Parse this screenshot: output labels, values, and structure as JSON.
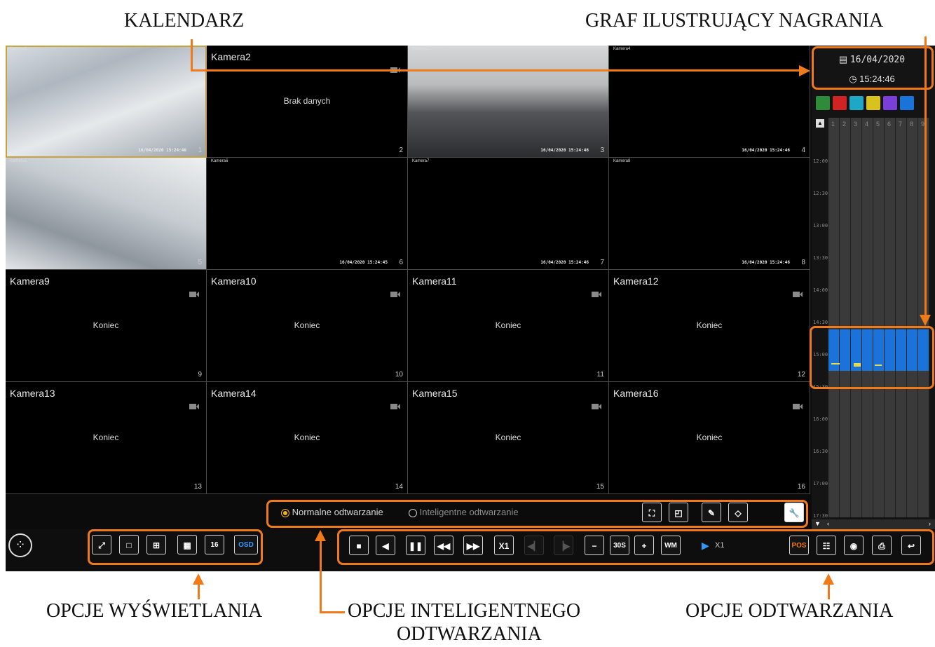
{
  "captions": {
    "calendar": "KALENDARZ",
    "recording_graph": "GRAF ILUSTRUJĄCY NAGRANIA",
    "display_options": "OPCJE WYŚWIETLANIA",
    "smart_playback_options_line1": "OPCJE INTELIGENTNEGO",
    "smart_playback_options_line2": "ODTWARZANIA",
    "playback_options": "OPCJE ODTWARZANIA"
  },
  "cameras": [
    {
      "name": "Kamera1",
      "status": "",
      "timestamp": "16/04/2020 15:24:46",
      "num": "1"
    },
    {
      "name": "Kamera2",
      "status": "Brak danych",
      "timestamp": "",
      "num": "2"
    },
    {
      "name": "Kamera3",
      "status": "",
      "timestamp": "16/04/2020 15:24:46",
      "num": "3"
    },
    {
      "name": "Kamera4",
      "status": "",
      "timestamp": "16/04/2020 15:24:46",
      "num": "4"
    },
    {
      "name": "Kamera5",
      "status": "",
      "timestamp": "",
      "num": "5"
    },
    {
      "name": "Kamera6",
      "status": "",
      "timestamp": "16/04/2020 15:24:45",
      "num": "6"
    },
    {
      "name": "Kamera7",
      "status": "",
      "timestamp": "16/04/2020 15:24:46",
      "num": "7"
    },
    {
      "name": "Kamera8",
      "status": "",
      "timestamp": "16/04/2020 15:24:46",
      "num": "8"
    },
    {
      "name": "Kamera9",
      "status": "Koniec",
      "timestamp": "",
      "num": "9"
    },
    {
      "name": "Kamera10",
      "status": "Koniec",
      "timestamp": "",
      "num": "10"
    },
    {
      "name": "Kamera11",
      "status": "Koniec",
      "timestamp": "",
      "num": "11"
    },
    {
      "name": "Kamera12",
      "status": "Koniec",
      "timestamp": "",
      "num": "12"
    },
    {
      "name": "Kamera13",
      "status": "Koniec",
      "timestamp": "",
      "num": "13"
    },
    {
      "name": "Kamera14",
      "status": "Koniec",
      "timestamp": "",
      "num": "14"
    },
    {
      "name": "Kamera15",
      "status": "Koniec",
      "timestamp": "",
      "num": "15"
    },
    {
      "name": "Kamera16",
      "status": "Koniec",
      "timestamp": "",
      "num": "16"
    }
  ],
  "date_panel": {
    "date": "16/04/2020",
    "time": "15:24:46"
  },
  "timeline": {
    "channels": [
      "1",
      "2",
      "3",
      "4",
      "5",
      "6",
      "7",
      "8",
      "9"
    ],
    "hours": [
      "12:00",
      "12:30",
      "13:00",
      "13:30",
      "14:00",
      "14:30",
      "15:00",
      "15:30",
      "16:00",
      "16:30",
      "17:00",
      "17:30"
    ]
  },
  "smart": {
    "normal": "Normalne odtwarzanie",
    "smart": "Inteligentne odtwarzanie"
  },
  "playback": {
    "speed": "X1",
    "step": "30S",
    "wm": "WM",
    "speed_indicator": "X1",
    "pos": "POS"
  },
  "display": {
    "osd": "OSD",
    "layout16": "16"
  },
  "colors": {
    "accent": "#f07a1a",
    "record": "#1a73d9",
    "marker": "#e8d84a"
  }
}
